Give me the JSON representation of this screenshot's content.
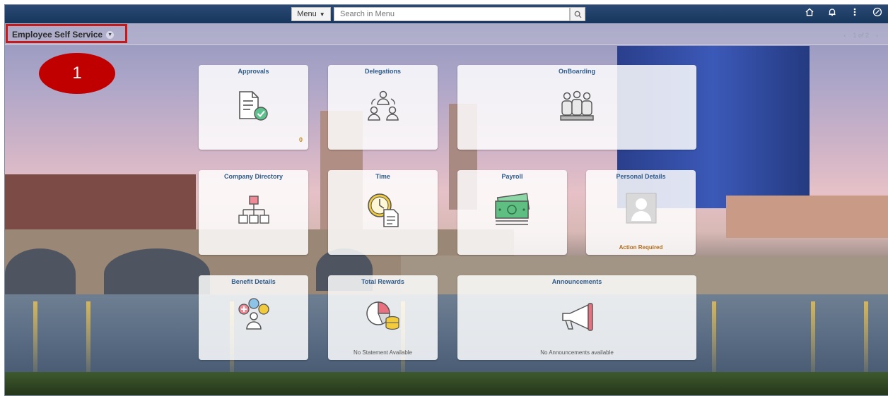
{
  "header": {
    "menu_label": "Menu",
    "search_placeholder": "Search in Menu",
    "icons": [
      "search-icon",
      "home-icon",
      "bell-icon",
      "more-vertical-icon",
      "compass-icon"
    ]
  },
  "page": {
    "title": "Employee Self Service",
    "pager": "1 of 2"
  },
  "callout": {
    "label": "1"
  },
  "tiles": [
    {
      "title": "Approvals",
      "count": "0",
      "footer": ""
    },
    {
      "title": "Delegations",
      "count": "",
      "footer": ""
    },
    {
      "title": "OnBoarding",
      "count": "",
      "footer": ""
    },
    {
      "title": "Company Directory",
      "count": "",
      "footer": ""
    },
    {
      "title": "Time",
      "count": "",
      "footer": ""
    },
    {
      "title": "Payroll",
      "count": "",
      "footer": ""
    },
    {
      "title": "Personal Details",
      "count": "",
      "footer": "Action Required"
    },
    {
      "title": "Benefit Details",
      "count": "",
      "footer": ""
    },
    {
      "title": "Total Rewards",
      "count": "",
      "footer": "No Statement Available"
    },
    {
      "title": "Announcements",
      "count": "",
      "footer": "No Announcements available"
    }
  ],
  "colors": {
    "header_bg": "#17365d",
    "tile_title": "#2f5b8a",
    "callout": "#c00000",
    "highlight_border": "#c21b1b",
    "warning_text": "#b06b1a"
  }
}
